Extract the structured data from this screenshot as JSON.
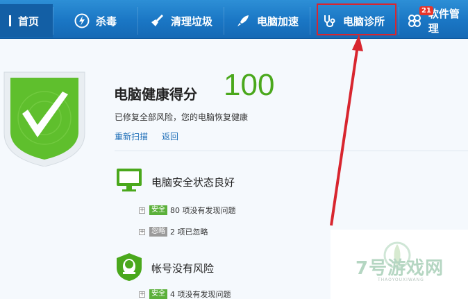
{
  "nav": {
    "tabs": [
      {
        "label": "首页",
        "active": true
      },
      {
        "label": "杀毒"
      },
      {
        "label": "清理垃圾"
      },
      {
        "label": "电脑加速"
      },
      {
        "label": "电脑诊所"
      },
      {
        "label": "软件管理"
      }
    ],
    "badge": "21"
  },
  "health": {
    "title": "电脑健康得分",
    "score": "100",
    "description": "已修复全部风险，您的电脑恢复健康",
    "rescan": "重新扫描",
    "back": "返回"
  },
  "sections": [
    {
      "title": "电脑安全状态良好",
      "rows": [
        {
          "tag": "安全",
          "text": "80 项没有发现问题"
        },
        {
          "tag": "忽略",
          "text": "2 项已忽略"
        }
      ]
    },
    {
      "title": "帐号没有风险",
      "rows": [
        {
          "tag": "安全",
          "text": "4 项没有发现问题"
        }
      ]
    }
  ],
  "watermark": {
    "text": "7号游戏网",
    "sub": "THAOYOUXIWANG"
  },
  "colors": {
    "nav": "#1a76c4",
    "score": "#4aa81c",
    "highlight": "#d8262f",
    "link": "#1f6fb8"
  }
}
